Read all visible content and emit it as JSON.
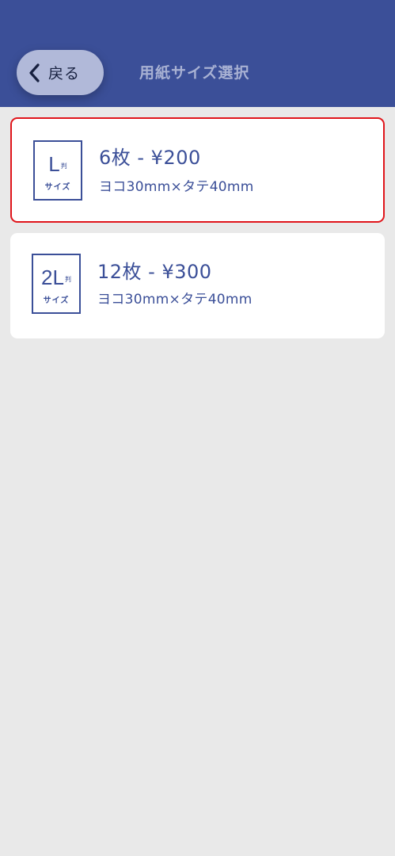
{
  "header": {
    "back_label": "戻る",
    "title": "用紙サイズ選択"
  },
  "options": [
    {
      "icon": {
        "size": "L",
        "han": "判",
        "kana": "サイズ"
      },
      "title": "6枚 - ¥200",
      "dimensions": "ヨコ30mm×タテ40mm",
      "selected": true
    },
    {
      "icon": {
        "size": "2L",
        "han": "判",
        "kana": "サイズ"
      },
      "title": "12枚 - ¥300",
      "dimensions": "ヨコ30mm×タテ40mm",
      "selected": false
    }
  ],
  "colors": {
    "header": "#3b4f98",
    "accent": "#3b4f98",
    "selected_border": "#e0151b",
    "background": "#e9e9e9"
  }
}
